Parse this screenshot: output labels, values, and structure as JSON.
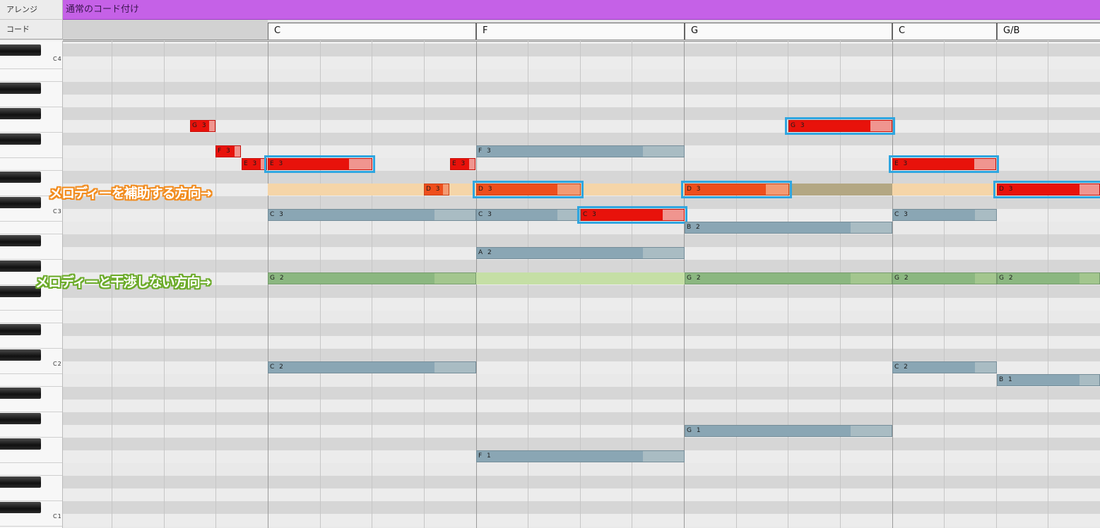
{
  "labels": {
    "arrange": "アレンジ",
    "chord": "コード"
  },
  "arrange_track": {
    "title": "通常のコード付け",
    "color": "#c561e7"
  },
  "chords": [
    "C",
    "F",
    "G",
    "C",
    "G/B"
  ],
  "keyboard_labels": [
    "C4",
    "C3",
    "C2",
    "C1"
  ],
  "annotations": {
    "support": {
      "text": "メロディーを補助する方向→",
      "color": "#f28c1e"
    },
    "avoid": {
      "text": "メロディーと干渉しない方向→",
      "color": "#6cab2a"
    }
  },
  "colors": {
    "melody": "#e8120b",
    "chord_note": "#8aa6b4",
    "highlight": "#2fa6e0",
    "support_band": "#f5d5a8",
    "avoid_band": "#c5dfa5"
  },
  "notes": [
    {
      "label": "G3",
      "kind": "melody"
    },
    {
      "label": "F3",
      "kind": "melody"
    },
    {
      "label": "E3",
      "kind": "melody"
    },
    {
      "label": "E3",
      "kind": "melody",
      "highlighted": true
    },
    {
      "label": "D3",
      "kind": "melody"
    },
    {
      "label": "E3",
      "kind": "melody"
    },
    {
      "label": "C3",
      "kind": "chord"
    },
    {
      "label": "C2",
      "kind": "chord"
    },
    {
      "label": "G2",
      "kind": "chord"
    },
    {
      "label": "F3",
      "kind": "chord"
    },
    {
      "label": "D3",
      "kind": "melody",
      "highlighted": true
    },
    {
      "label": "C3",
      "kind": "chord"
    },
    {
      "label": "C3",
      "kind": "melody",
      "highlighted": true
    },
    {
      "label": "A2",
      "kind": "chord"
    },
    {
      "label": "F1",
      "kind": "chord"
    },
    {
      "label": "D3",
      "kind": "melody",
      "highlighted": true
    },
    {
      "label": "B2",
      "kind": "chord"
    },
    {
      "label": "G2",
      "kind": "chord"
    },
    {
      "label": "G1",
      "kind": "chord"
    },
    {
      "label": "G3",
      "kind": "melody",
      "highlighted": true
    },
    {
      "label": "E3",
      "kind": "melody",
      "highlighted": true
    },
    {
      "label": "C3",
      "kind": "chord"
    },
    {
      "label": "G2",
      "kind": "chord"
    },
    {
      "label": "C2",
      "kind": "chord"
    },
    {
      "label": "D3",
      "kind": "melody",
      "highlighted": true
    },
    {
      "label": "G2",
      "kind": "chord"
    },
    {
      "label": "B1",
      "kind": "chord"
    }
  ]
}
